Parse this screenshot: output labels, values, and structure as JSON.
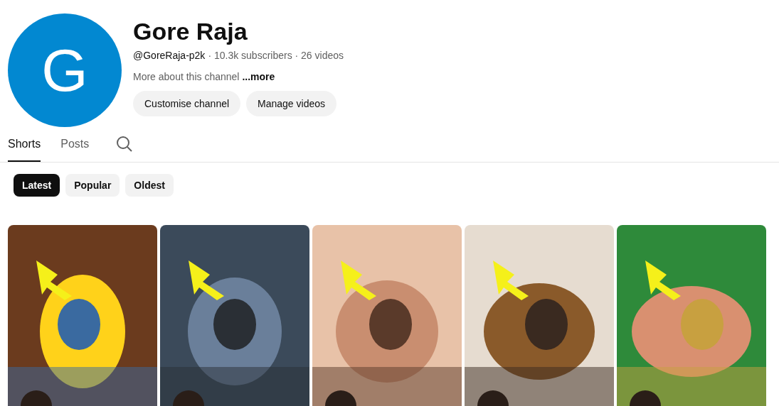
{
  "channel": {
    "avatar_letter": "G",
    "name": "Gore Raja",
    "handle": "@GoreRaja-p2k",
    "stats": "· 10.3k subscribers · 26 videos",
    "description": "More about this channel",
    "more_link": "...more",
    "buttons": [
      "Customise channel",
      "Manage videos"
    ]
  },
  "tabs": [
    {
      "label": "Shorts",
      "selected": true
    },
    {
      "label": "Posts",
      "selected": false
    }
  ],
  "filters": [
    {
      "label": "Latest",
      "selected": true
    },
    {
      "label": "Popular",
      "selected": false
    },
    {
      "label": "Oldest",
      "selected": false
    }
  ]
}
